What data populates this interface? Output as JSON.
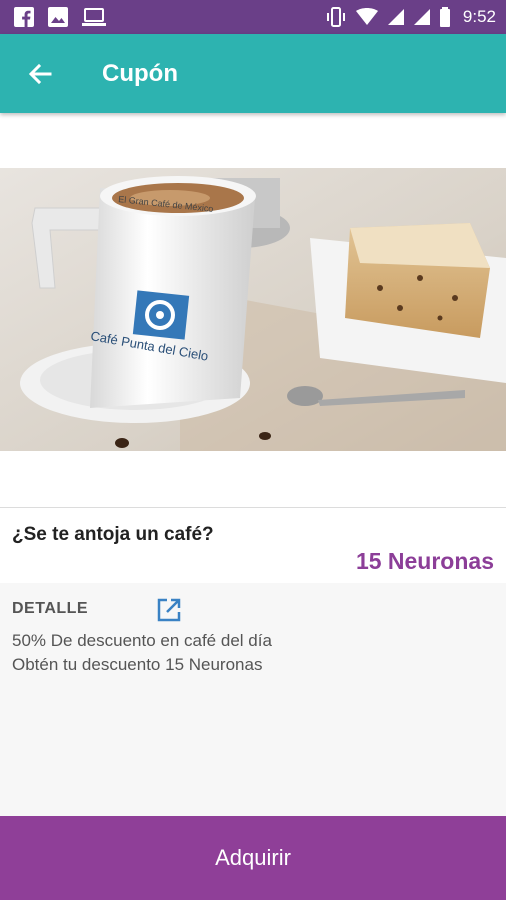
{
  "status_bar": {
    "time": "9:52",
    "left_icons": [
      "facebook-icon",
      "image-icon",
      "laptop-icon"
    ],
    "right_icons": [
      "vibrate-icon",
      "wifi-icon",
      "signal-icon",
      "signal-icon-2",
      "battery-icon"
    ]
  },
  "app_bar": {
    "title": "Cupón",
    "back_icon": "arrow-back-icon"
  },
  "hero": {
    "cup_text_rim": "El Gran Café de México",
    "cup_text_brand": "Café Punta del Cielo"
  },
  "coupon": {
    "title": "¿Se te antoja un café?",
    "price": "15 Neuronas"
  },
  "detail": {
    "label": "DETALLE",
    "link_icon": "open-in-new-icon",
    "line1": "50% De descuento en café del día",
    "line2": "Obtén tu descuento 15 Neuronas"
  },
  "actions": {
    "acquire_label": "Adquirir"
  },
  "colors": {
    "status_bar": "#6a3f88",
    "app_bar": "#2db3b0",
    "accent": "#8c3e98",
    "button": "#8f3f98"
  }
}
